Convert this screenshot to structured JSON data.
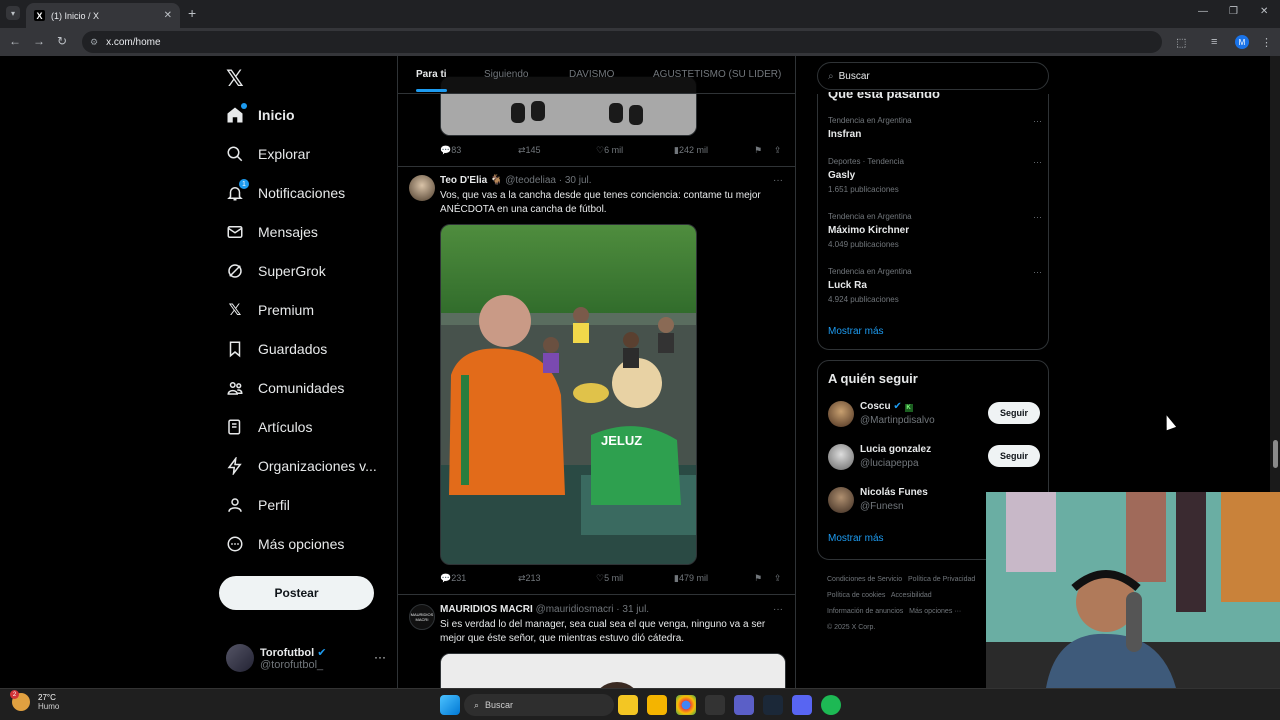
{
  "browser": {
    "tab_title": "(1) Inicio / X",
    "url": "x.com/home",
    "profile_initial": "M"
  },
  "sidebar": {
    "items": [
      {
        "label": "Inicio",
        "icon": "home-icon"
      },
      {
        "label": "Explorar",
        "icon": "search-icon"
      },
      {
        "label": "Notificaciones",
        "icon": "bell-icon",
        "badge": "1"
      },
      {
        "label": "Mensajes",
        "icon": "mail-icon"
      },
      {
        "label": "SuperGrok",
        "icon": "grok-icon"
      },
      {
        "label": "Premium",
        "icon": "x-logo-icon"
      },
      {
        "label": "Guardados",
        "icon": "bookmark-icon"
      },
      {
        "label": "Comunidades",
        "icon": "people-icon"
      },
      {
        "label": "Artículos",
        "icon": "article-icon"
      },
      {
        "label": "Organizaciones v...",
        "icon": "lightning-icon"
      },
      {
        "label": "Perfil",
        "icon": "person-icon"
      },
      {
        "label": "Más opciones",
        "icon": "more-circle-icon"
      }
    ],
    "post_button": "Postear",
    "account": {
      "name": "Torofutbol",
      "handle": "@torofutbol_"
    }
  },
  "feed": {
    "tabs": [
      "Para ti",
      "Siguiendo",
      "DAVISMO",
      "AGUSTETISMO (SU LIDER)"
    ],
    "tweet0_actions": {
      "replies": "83",
      "reposts": "145",
      "likes": "6 mil",
      "views": "242 mil"
    },
    "tweet1": {
      "name": "Teo D'Elia 🐐",
      "handle": "@teodeliaa",
      "date": "· 30 jul.",
      "text": "Vos, que vas a la cancha desde que tenes conciencia: contame tu mejor ANÉCDOTA en una cancha de fútbol.",
      "jersey_text": "JELUZ",
      "actions": {
        "replies": "231",
        "reposts": "213",
        "likes": "5 mil",
        "views": "479 mil"
      }
    },
    "tweet2": {
      "name": "MAURIDIOS MACRI",
      "handle": "@mauridiosmacri",
      "date": "· 31 jul.",
      "text": "Si es verdad lo del manager, sea cual sea el que venga, ninguno va a ser mejor que éste señor, que mientras estuvo dió cátedra.",
      "avatar_text": "MAURIDIOS MACRI"
    }
  },
  "right": {
    "search_placeholder": "Buscar",
    "trends_title": "Qué está pasando",
    "trends": [
      {
        "context": "Tendencia en Argentina",
        "title": "Insfran",
        "count": ""
      },
      {
        "context": "Deportes · Tendencia",
        "title": "Gasly",
        "count": "1.651 publicaciones"
      },
      {
        "context": "Tendencia en Argentina",
        "title": "Máximo Kirchner",
        "count": "4.049 publicaciones"
      },
      {
        "context": "Tendencia en Argentina",
        "title": "Luck Ra",
        "count": "4.924 publicaciones"
      }
    ],
    "show_more": "Mostrar más",
    "who_to_follow_title": "A quién seguir",
    "follow": [
      {
        "name": "Coscu",
        "handle": "@Martinpdisalvo",
        "button": "Seguir"
      },
      {
        "name": "Lucia gonzalez",
        "handle": "@luciapeppa",
        "button": "Seguir"
      },
      {
        "name": "Nicolás Funes",
        "handle": "@Funesn",
        "button": ""
      }
    ],
    "show_more_2": "Mostrar más",
    "footer": {
      "l1": "Condiciones de Servicio",
      "l2": "Política de Privacidad",
      "l3": "Política de cookies",
      "l4": "Accesibilidad",
      "l5": "Información de anuncios",
      "l6": "Más opciones ···",
      "l7": "© 2025 X Corp."
    }
  },
  "taskbar": {
    "temp": "27°C",
    "condition": "Humo",
    "weather_badge": "2",
    "search": "Buscar"
  }
}
